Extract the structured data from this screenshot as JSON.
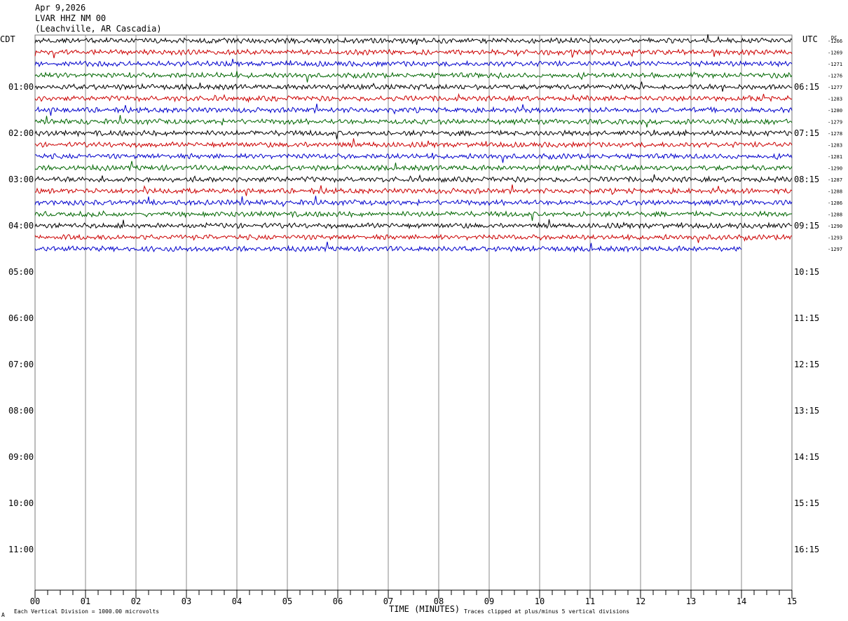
{
  "header": {
    "date": "Apr 9,2026",
    "station": "LVAR HHZ NM 00",
    "location": "(Leachville, AR Cascadia)"
  },
  "axis": {
    "left_label": "CDT",
    "right_label": "UTC",
    "dc_label": "DC",
    "x_title": "TIME (MINUTES)"
  },
  "footer": {
    "scale_note": "Each Vertical Division = 1000.00 microvolts",
    "clip_note": "Traces clipped at plus/minus 5 vertical divisions",
    "corner_mark": "A"
  },
  "chart_data": {
    "type": "line",
    "title": "LVAR HHZ NM 00",
    "xlabel": "TIME (MINUTES)",
    "xlim": [
      0,
      15
    ],
    "x_ticks": [
      "00",
      "01",
      "02",
      "03",
      "04",
      "05",
      "06",
      "07",
      "08",
      "09",
      "10",
      "11",
      "12",
      "13",
      "14",
      "15"
    ],
    "cdt_hour_labels": [
      "01:00",
      "02:00",
      "03:00",
      "04:00",
      "05:00",
      "06:00",
      "07:00",
      "08:00",
      "09:00",
      "10:00",
      "11:00"
    ],
    "utc_hour_labels": [
      "06:15",
      "07:15",
      "08:15",
      "09:15",
      "10:15",
      "11:15",
      "12:15",
      "13:15",
      "14:15",
      "15:15",
      "16:15"
    ],
    "rows_per_hour": 4,
    "minutes_per_row": 15,
    "trace_colors": [
      "#000000",
      "#cc0000",
      "#0000cc",
      "#006600"
    ],
    "grid": true,
    "series": [
      {
        "row": 0,
        "dc": "-1266",
        "end_minute": 15
      },
      {
        "row": 1,
        "dc": "-1269",
        "end_minute": 15
      },
      {
        "row": 2,
        "dc": "-1271",
        "end_minute": 15
      },
      {
        "row": 3,
        "dc": "-1276",
        "end_minute": 15
      },
      {
        "row": 4,
        "dc": "-1277",
        "end_minute": 15
      },
      {
        "row": 5,
        "dc": "-1283",
        "end_minute": 15
      },
      {
        "row": 6,
        "dc": "-1280",
        "end_minute": 15
      },
      {
        "row": 7,
        "dc": "-1279",
        "end_minute": 15
      },
      {
        "row": 8,
        "dc": "-1278",
        "end_minute": 15
      },
      {
        "row": 9,
        "dc": "-1283",
        "end_minute": 15
      },
      {
        "row": 10,
        "dc": "-1281",
        "end_minute": 15
      },
      {
        "row": 11,
        "dc": "-1290",
        "end_minute": 15
      },
      {
        "row": 12,
        "dc": "-1287",
        "end_minute": 15
      },
      {
        "row": 13,
        "dc": "-1288",
        "end_minute": 15
      },
      {
        "row": 14,
        "dc": "-1286",
        "end_minute": 15
      },
      {
        "row": 15,
        "dc": "-1288",
        "end_minute": 15
      },
      {
        "row": 16,
        "dc": "-1290",
        "end_minute": 15
      },
      {
        "row": 17,
        "dc": "-1293",
        "end_minute": 15
      },
      {
        "row": 18,
        "dc": "-1297",
        "end_minute": 14
      }
    ]
  }
}
